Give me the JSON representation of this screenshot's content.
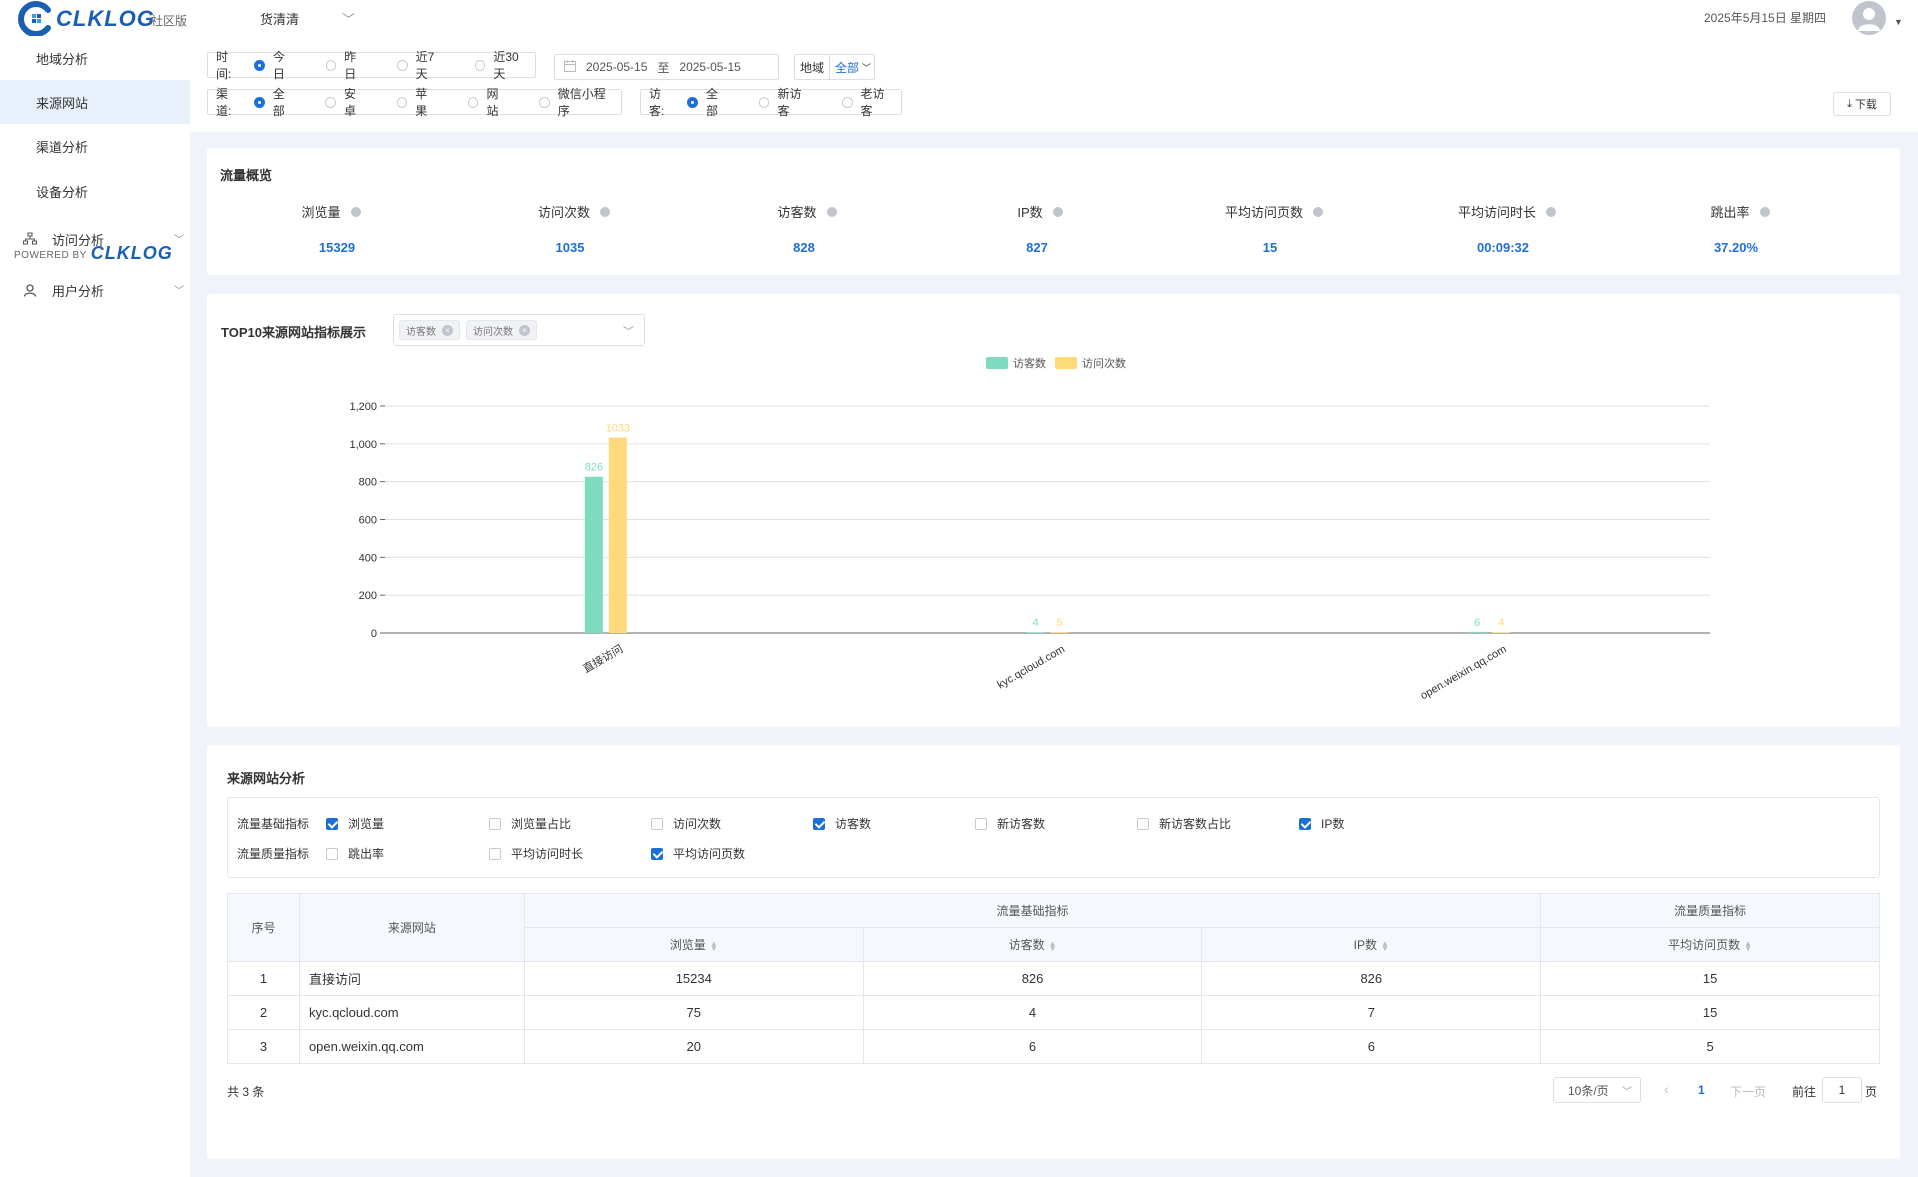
{
  "header": {
    "brand": "CLKLOG",
    "edition": "社区版",
    "project": "货清清",
    "date": "2025年5月15日 星期四"
  },
  "sidebar": {
    "items": [
      {
        "label": "地域分析"
      },
      {
        "label": "来源网站"
      },
      {
        "label": "渠道分析"
      },
      {
        "label": "设备分析"
      }
    ],
    "groups": [
      {
        "label": "访问分析"
      },
      {
        "label": "用户分析"
      }
    ],
    "powered_by": "POWERED BY",
    "powered_brand": "CLKLOG"
  },
  "filters": {
    "time_label": "时间:",
    "time_options": [
      "今日",
      "昨日",
      "近7天",
      "近30天"
    ],
    "date_start": "2025-05-15",
    "date_sep": "至",
    "date_end": "2025-05-15",
    "region_label": "地域",
    "region_value": "全部",
    "channel_label": "渠道:",
    "channel_options": [
      "全部",
      "安卓",
      "苹果",
      "网站",
      "微信小程序"
    ],
    "visitor_label": "访客:",
    "visitor_options": [
      "全部",
      "新访客",
      "老访客"
    ],
    "download": "下载"
  },
  "overview": {
    "title": "流量概览",
    "metrics": [
      {
        "label": "浏览量",
        "value": "15329"
      },
      {
        "label": "访问次数",
        "value": "1035"
      },
      {
        "label": "访客数",
        "value": "828"
      },
      {
        "label": "IP数",
        "value": "827"
      },
      {
        "label": "平均访问页数",
        "value": "15"
      },
      {
        "label": "平均访问时长",
        "value": "00:09:32"
      },
      {
        "label": "跳出率",
        "value": "37.20%"
      }
    ]
  },
  "top10": {
    "title": "TOP10来源网站指标展示",
    "tags": [
      "访客数",
      "访问次数"
    ]
  },
  "chart_data": {
    "type": "bar",
    "categories": [
      "直接访问",
      "kyc.qcloud.com",
      "open.weixin.qq.com"
    ],
    "series": [
      {
        "name": "访客数",
        "values": [
          826,
          4,
          6
        ],
        "color": "#7ddcc0"
      },
      {
        "name": "访问次数",
        "values": [
          1033,
          5,
          4
        ],
        "color": "#ffd97a"
      }
    ],
    "ylim": [
      0,
      1200
    ],
    "yticks": [
      "0",
      "200",
      "400",
      "600",
      "800",
      "1,000",
      "1,200"
    ],
    "grid": true,
    "legend": "top"
  },
  "analysis": {
    "title": "来源网站分析",
    "basic_label": "流量基础指标",
    "quality_label": "流量质量指标",
    "basic_checks": [
      {
        "label": "浏览量",
        "checked": true
      },
      {
        "label": "浏览量占比",
        "checked": false
      },
      {
        "label": "访问次数",
        "checked": false
      },
      {
        "label": "访客数",
        "checked": true
      },
      {
        "label": "新访客数",
        "checked": false
      },
      {
        "label": "新访客数占比",
        "checked": false
      },
      {
        "label": "IP数",
        "checked": true
      }
    ],
    "quality_checks": [
      {
        "label": "跳出率",
        "checked": false
      },
      {
        "label": "平均访问时长",
        "checked": false
      },
      {
        "label": "平均访问页数",
        "checked": true
      }
    ]
  },
  "table": {
    "h_index": "序号",
    "h_source": "来源网站",
    "h_basic": "流量基础指标",
    "h_quality": "流量质量指标",
    "h_pv": "浏览量",
    "h_uv": "访客数",
    "h_ip": "IP数",
    "h_avg_pages": "平均访问页数",
    "rows": [
      [
        "1",
        "直接访问",
        "15234",
        "826",
        "826",
        "15"
      ],
      [
        "2",
        "kyc.qcloud.com",
        "75",
        "4",
        "7",
        "15"
      ],
      [
        "3",
        "open.weixin.qq.com",
        "20",
        "6",
        "6",
        "5"
      ]
    ]
  },
  "pagination": {
    "total": "共 3 条",
    "page_size": "10条/页",
    "prev": "‹",
    "current": "1",
    "next": "下一页",
    "goto": "前往",
    "goto_value": "1",
    "page_unit": "页"
  }
}
